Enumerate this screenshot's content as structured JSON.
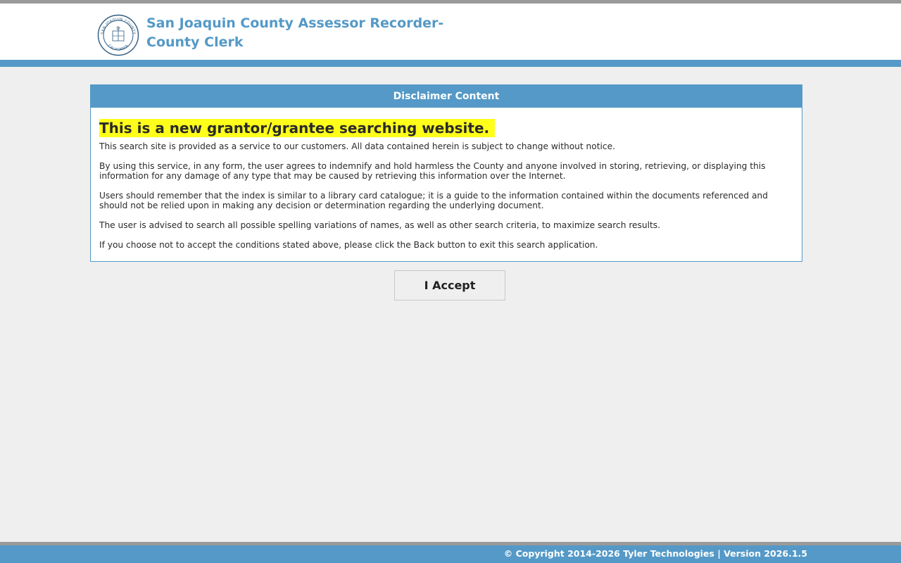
{
  "header": {
    "title_line1": "San Joaquin County Assessor Recorder-",
    "title_line2": "County Clerk",
    "logo_icon": "county-seal-icon",
    "brand_color": "#5499c7"
  },
  "disclaimer": {
    "header": "Disclaimer Content",
    "headline": "This is a new grantor/grantee searching website.",
    "highlight_color": "#ffff1a",
    "paragraphs": [
      "This search site is provided as a service to our customers. All data contained herein is subject to change without notice.",
      "By using this service, in any form, the user agrees to indemnify and hold harmless the County and anyone involved in storing, retrieving, or displaying this information for any damage of any type that may be caused by retrieving this information over the Internet.",
      "Users should remember that the index is similar to a library card catalogue; it is a guide to the information contained within the documents referenced and should not be relied upon in making any decision or determination regarding the underlying document.",
      "The user is advised to search all possible spelling variations of names, as well as other search criteria, to maximize search results.",
      "If you choose not to accept the conditions stated above, please click the Back button to exit this search application."
    ]
  },
  "accept_button_label": "I Accept",
  "footer": {
    "text": "© Copyright 2014-2026 Tyler Technologies | Version 2026.1.5"
  }
}
